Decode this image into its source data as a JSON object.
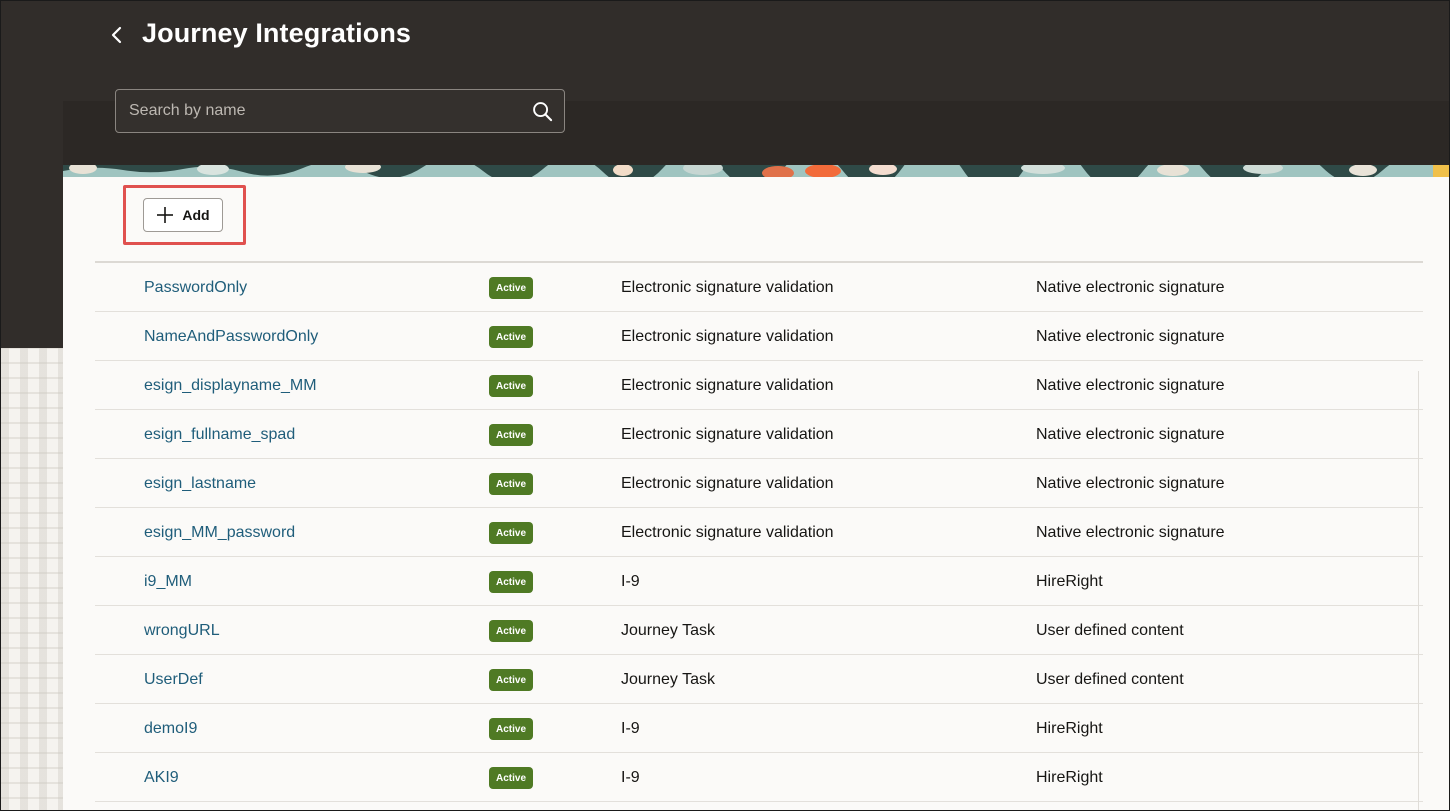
{
  "header": {
    "title": "Journey Integrations",
    "back_icon": "chevron-left-icon"
  },
  "search": {
    "placeholder": "Search by name",
    "value": "",
    "icon": "search-icon"
  },
  "toolbar": {
    "add_label": "Add",
    "add_icon": "plus-icon"
  },
  "colors": {
    "header_bg": "#312d2a",
    "panel_bg": "#fbfaf8",
    "link": "#1f5d7a",
    "badge_active": "#4f7a24",
    "highlight": "#e0514f"
  },
  "integrations": [
    {
      "name": "PasswordOnly",
      "status": "Active",
      "type": "Electronic signature validation",
      "provider": "Native electronic signature"
    },
    {
      "name": "NameAndPasswordOnly",
      "status": "Active",
      "type": "Electronic signature validation",
      "provider": "Native electronic signature"
    },
    {
      "name": "esign_displayname_MM",
      "status": "Active",
      "type": "Electronic signature validation",
      "provider": "Native electronic signature"
    },
    {
      "name": "esign_fullname_spad",
      "status": "Active",
      "type": "Electronic signature validation",
      "provider": "Native electronic signature"
    },
    {
      "name": "esign_lastname",
      "status": "Active",
      "type": "Electronic signature validation",
      "provider": "Native electronic signature"
    },
    {
      "name": "esign_MM_password",
      "status": "Active",
      "type": "Electronic signature validation",
      "provider": "Native electronic signature"
    },
    {
      "name": "i9_MM",
      "status": "Active",
      "type": "I-9",
      "provider": "HireRight"
    },
    {
      "name": "wrongURL",
      "status": "Active",
      "type": "Journey Task",
      "provider": "User defined content"
    },
    {
      "name": "UserDef",
      "status": "Active",
      "type": "Journey Task",
      "provider": "User defined content"
    },
    {
      "name": "demoI9",
      "status": "Active",
      "type": "I-9",
      "provider": "HireRight"
    },
    {
      "name": "AKI9",
      "status": "Active",
      "type": "I-9",
      "provider": "HireRight"
    }
  ]
}
